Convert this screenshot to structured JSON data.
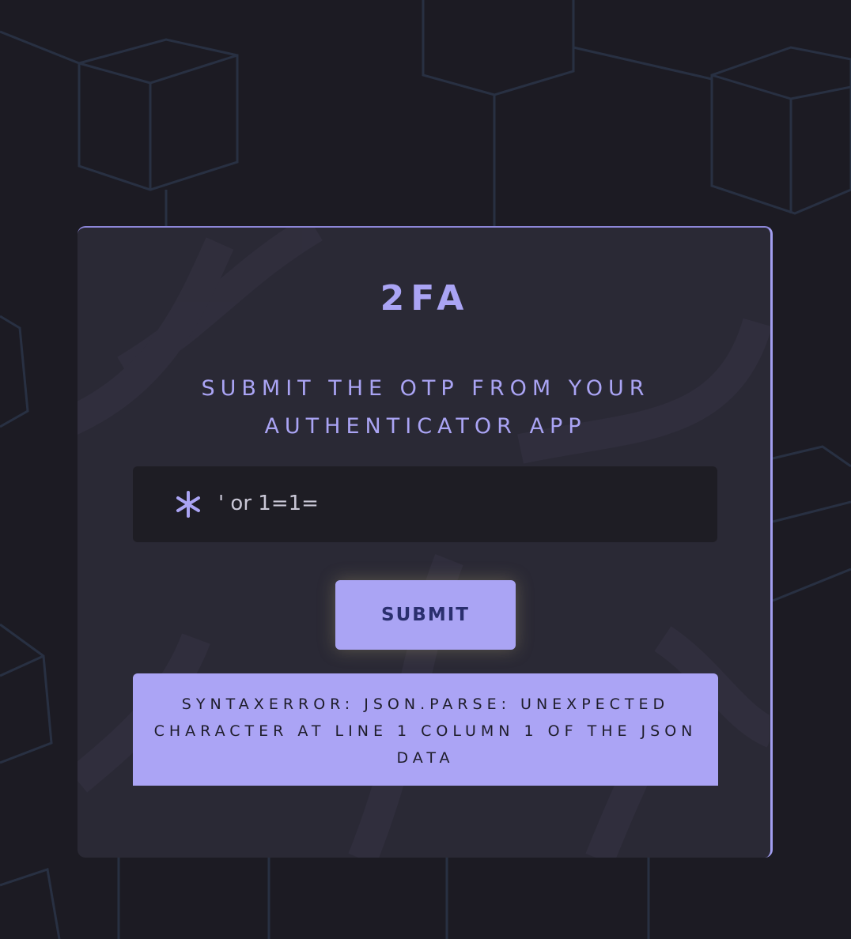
{
  "card": {
    "title": "2FA",
    "subtitle": "SUBMIT THE OTP FROM YOUR AUTHENTICATOR APP"
  },
  "otp": {
    "icon": "asterisk-icon",
    "value": "' or 1=1="
  },
  "submit": {
    "label": "SUBMIT"
  },
  "error": {
    "message": "SYNTAXERROR: JSON.PARSE: UNEXPECTED CHARACTER AT LINE 1 COLUMN 1 OF THE JSON DATA"
  },
  "colors": {
    "accent": "#aaa4f4",
    "card": "#2a2935",
    "background": "#1c1b23",
    "field": "#1e1d24",
    "button_text": "#2a2f6e"
  }
}
